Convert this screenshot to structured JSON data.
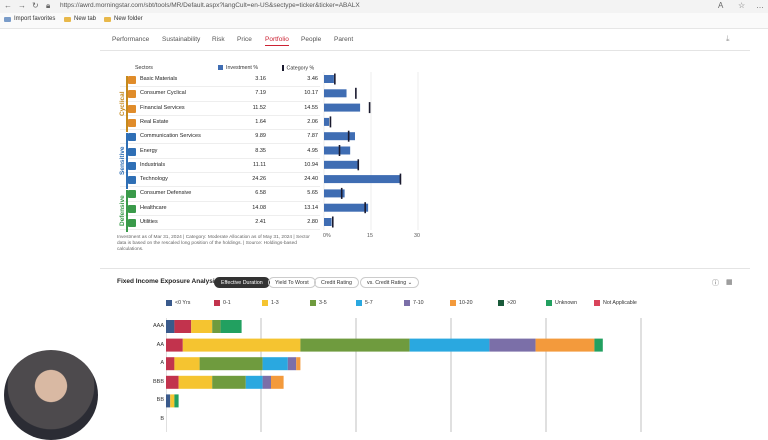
{
  "browser": {
    "url": "https://awrd.morningstar.com/sbt/tools/MR/Default.aspx?langCult=en-US&sectype=ticker&ticker=ABALX",
    "bookmarks": [
      "Import favorites",
      "New tab",
      "New folder"
    ]
  },
  "nav": {
    "tabs": [
      "Performance",
      "Sustainability",
      "Risk",
      "Price",
      "Portfolio",
      "People",
      "Parent"
    ],
    "active": "Portfolio"
  },
  "sectors": {
    "col_sectors": "Sectors",
    "col_investment": "Investment %",
    "col_category": "Category %",
    "groups": [
      "Cyclical",
      "Sensitive",
      "Defensive"
    ],
    "rows": [
      {
        "name": "Basic Materials",
        "inv": "3.16",
        "cat": "3.46",
        "group": "Cyclical"
      },
      {
        "name": "Consumer Cyclical",
        "inv": "7.19",
        "cat": "10.17",
        "group": "Cyclical"
      },
      {
        "name": "Financial Services",
        "inv": "11.52",
        "cat": "14.55",
        "group": "Cyclical"
      },
      {
        "name": "Real Estate",
        "inv": "1.64",
        "cat": "2.06",
        "group": "Cyclical"
      },
      {
        "name": "Communication Services",
        "inv": "9.89",
        "cat": "7.87",
        "group": "Sensitive"
      },
      {
        "name": "Energy",
        "inv": "8.35",
        "cat": "4.95",
        "group": "Sensitive"
      },
      {
        "name": "Industrials",
        "inv": "11.11",
        "cat": "10.94",
        "group": "Sensitive"
      },
      {
        "name": "Technology",
        "inv": "24.26",
        "cat": "24.40",
        "group": "Sensitive"
      },
      {
        "name": "Consumer Defensive",
        "inv": "6.58",
        "cat": "5.65",
        "group": "Defensive"
      },
      {
        "name": "Healthcare",
        "inv": "14.08",
        "cat": "13.14",
        "group": "Defensive"
      },
      {
        "name": "Utilities",
        "inv": "2.41",
        "cat": "2.80",
        "group": "Defensive"
      }
    ],
    "note": "Investment as of Mar 31, 2024 | Category: Moderate Allocation as of May 31, 2024 | Sector data is based on the rescaled long position of the holdings. | Source: Holdings-based calculations."
  },
  "fixed_income": {
    "title": "Fixed Income Exposure Analysis",
    "pills": [
      "Effective Duration",
      "Yield To Worst",
      "Credit Rating",
      "vs. Credit Rating"
    ],
    "active_pill": "Effective Duration",
    "legend": [
      {
        "label": "<0 Yrs",
        "color": "#3a5a8c"
      },
      {
        "label": "0-1",
        "color": "#c2334d"
      },
      {
        "label": "1-3",
        "color": "#f5c430"
      },
      {
        "label": "3-5",
        "color": "#6f9b3e"
      },
      {
        "label": "5-7",
        "color": "#2aa8e0"
      },
      {
        "label": "7-10",
        "color": "#7b6fa8"
      },
      {
        "label": "10-20",
        "color": "#f39a3c"
      },
      {
        "label": ">20",
        "color": "#1a5a3a"
      },
      {
        "label": "Unknown",
        "color": "#22a060"
      },
      {
        "label": "Not Applicable",
        "color": "#d9435a"
      }
    ]
  },
  "chart_data": [
    {
      "type": "bar",
      "title": "",
      "categories": [
        "Basic Materials",
        "Consumer Cyclical",
        "Financial Services",
        "Real Estate",
        "Communication Services",
        "Energy",
        "Industrials",
        "Technology",
        "Consumer Defensive",
        "Healthcare",
        "Utilities"
      ],
      "series": [
        {
          "name": "Investment %",
          "values": [
            3.16,
            7.19,
            11.52,
            1.64,
            9.89,
            8.35,
            11.11,
            24.26,
            6.58,
            14.08,
            2.41
          ]
        },
        {
          "name": "Category %",
          "values": [
            3.46,
            10.17,
            14.55,
            2.06,
            7.87,
            4.95,
            10.94,
            24.4,
            5.65,
            13.14,
            2.8
          ]
        }
      ],
      "xticks": [
        "0%",
        "15",
        "30"
      ],
      "xlim": [
        0,
        30
      ],
      "colors": {
        "investment": "#3f6db3",
        "category": "#1a1a2e"
      }
    },
    {
      "type": "bar",
      "stacked": true,
      "categories": [
        "AAA",
        "AA",
        "A",
        "BBB",
        "BB",
        "B"
      ],
      "series": [
        {
          "name": "<0 Yrs",
          "values": [
            2,
            0,
            0,
            0,
            1,
            0
          ]
        },
        {
          "name": "0-1",
          "values": [
            4,
            4,
            2,
            3,
            0,
            0
          ]
        },
        {
          "name": "1-3",
          "values": [
            5,
            28,
            6,
            8,
            1,
            0
          ]
        },
        {
          "name": "3-5",
          "values": [
            2,
            26,
            15,
            8,
            0,
            0
          ]
        },
        {
          "name": "5-7",
          "values": [
            0,
            19,
            6,
            4,
            0,
            0
          ]
        },
        {
          "name": "7-10",
          "values": [
            0,
            11,
            2,
            2,
            0,
            0
          ]
        },
        {
          "name": "10-20",
          "values": [
            0,
            14,
            1,
            3,
            0,
            0
          ]
        },
        {
          "name": ">20",
          "values": [
            0,
            0,
            0,
            0,
            0,
            0
          ]
        },
        {
          "name": "Unknown",
          "values": [
            5,
            2,
            0,
            0,
            1,
            0
          ]
        },
        {
          "name": "Not Applicable",
          "values": [
            0,
            0,
            0,
            0,
            0,
            0
          ]
        }
      ]
    }
  ]
}
